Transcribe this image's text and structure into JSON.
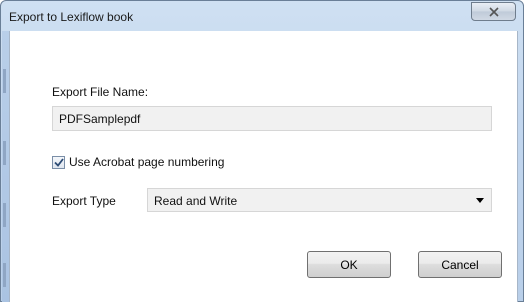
{
  "window": {
    "title": "Export to Lexiflow book"
  },
  "form": {
    "filename_label": "Export File Name:",
    "filename_value": "PDFSamplepdf",
    "acrobat_numbering_label": "Use Acrobat page numbering",
    "acrobat_numbering_checked": true,
    "export_type_label": "Export Type",
    "export_type_value": "Read and Write"
  },
  "buttons": {
    "ok": "OK",
    "cancel": "Cancel"
  },
  "icons": {
    "close": "close-icon",
    "dropdown": "chevron-down-icon",
    "check": "checkmark-icon"
  }
}
